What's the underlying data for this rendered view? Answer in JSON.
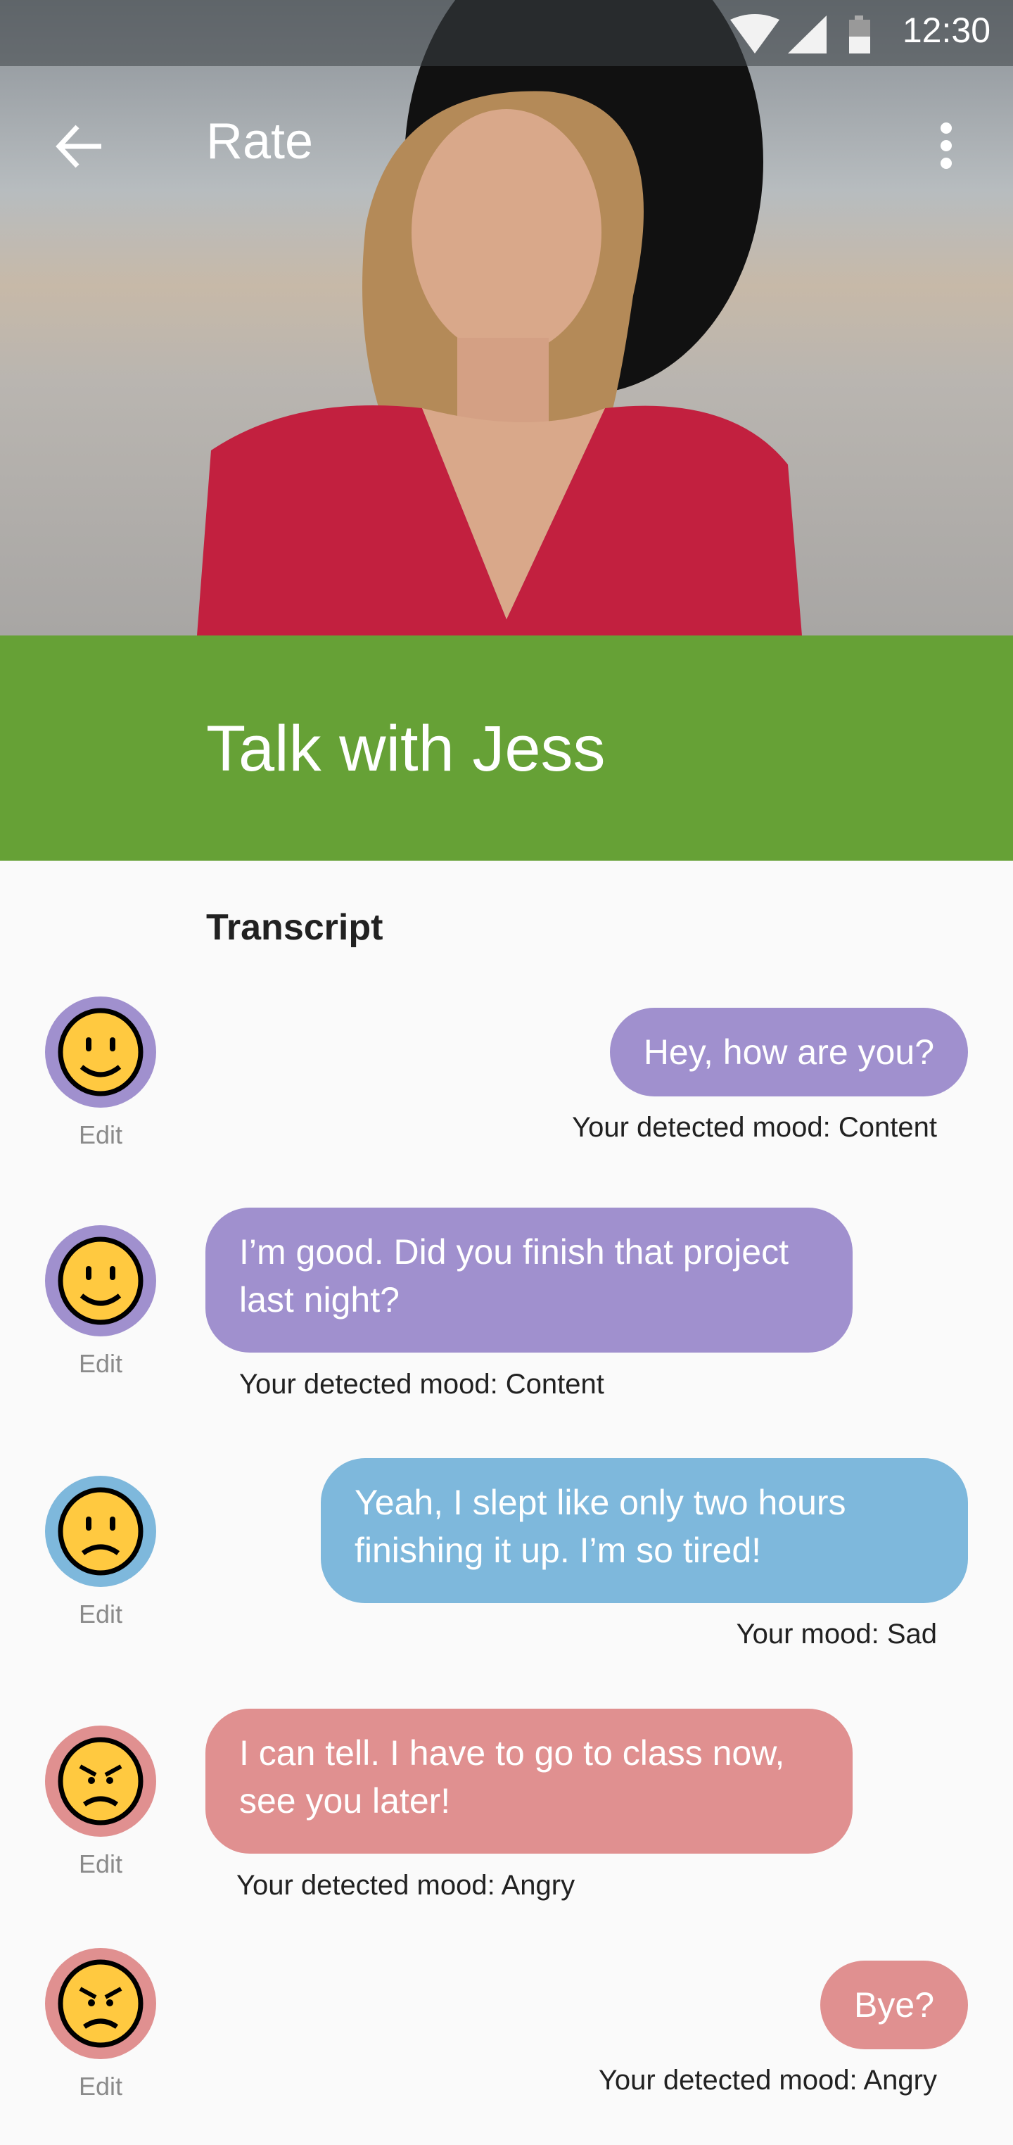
{
  "status_bar": {
    "time": "12:30",
    "icons": [
      "wifi-icon",
      "signal-icon",
      "battery-icon"
    ]
  },
  "toolbar": {
    "title": "Rate",
    "back_icon": "arrow-back-icon",
    "menu_icon": "more-vert-icon"
  },
  "banner": {
    "title": "Talk with Jess",
    "color": "#66a136"
  },
  "transcript": {
    "heading": "Transcript",
    "edit_label": "Edit",
    "messages": [
      {
        "text": "Hey, how are you?",
        "mood": "Your detected mood: Content",
        "face": "smile-face-icon",
        "color": "#a090ce"
      },
      {
        "text": "I’m good. Did you finish that project last night?",
        "mood": "Your detected mood: Content",
        "face": "smile-face-icon",
        "color": "#a090ce"
      },
      {
        "text": "Yeah, I slept like only two hours finishing it up. I’m so tired!",
        "mood": "Your mood: Sad",
        "face": "sad-face-icon",
        "color": "#7eb8dc"
      },
      {
        "text": "I can tell. I have to go to class now, see you later!",
        "mood": "Your detected mood: Angry",
        "face": "angry-face-icon",
        "color": "#e09090"
      },
      {
        "text": "Bye?",
        "mood": "Your detected mood: Angry",
        "face": "angry-face-icon",
        "color": "#e09090"
      }
    ]
  }
}
